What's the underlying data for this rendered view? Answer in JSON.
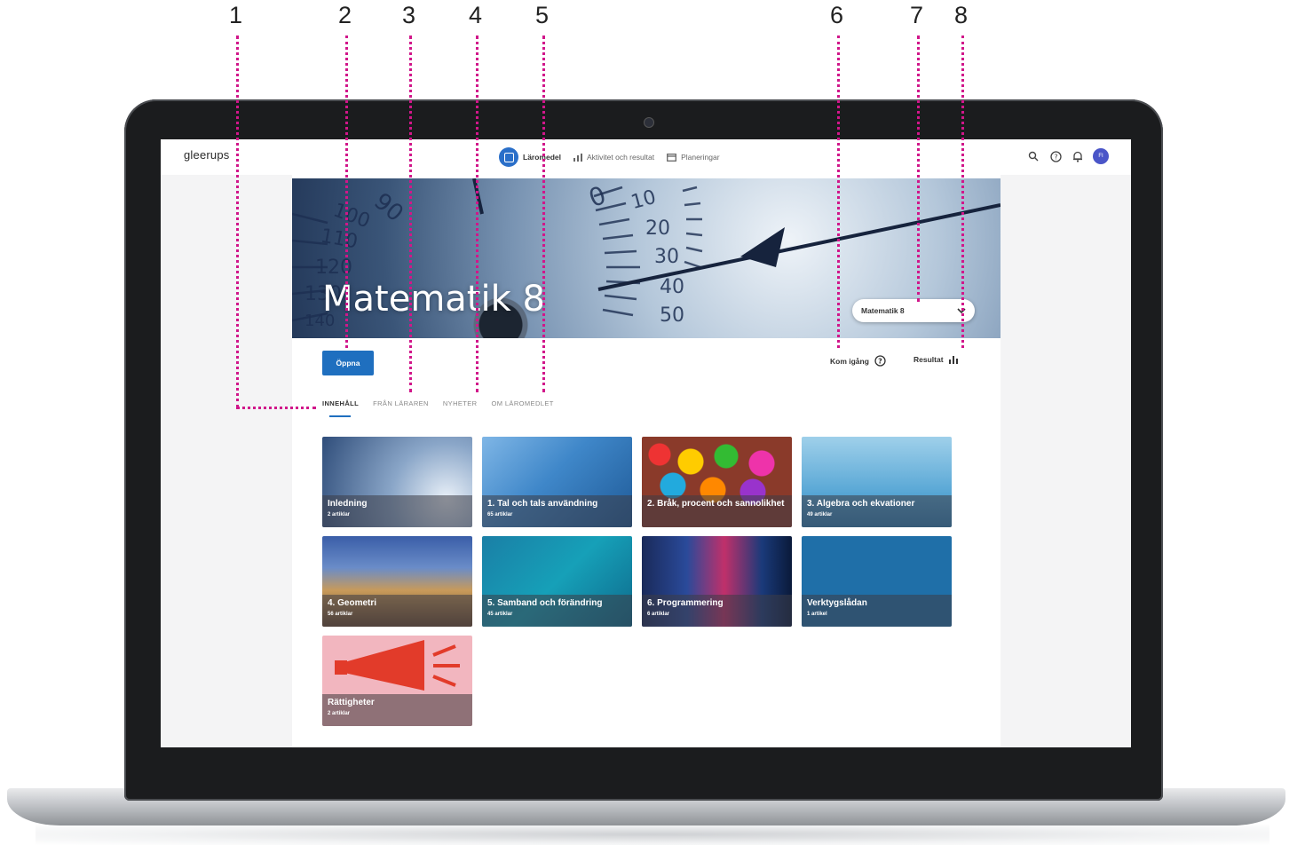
{
  "callouts": [
    "1",
    "2",
    "3",
    "4",
    "5",
    "6",
    "7",
    "8"
  ],
  "header": {
    "logo": "gleerups",
    "nav": [
      {
        "label": "Läromedel",
        "active": true
      },
      {
        "label": "Aktivitet och resultat",
        "active": false
      },
      {
        "label": "Planeringar",
        "active": false
      }
    ],
    "avatar_initials": "FI"
  },
  "hero": {
    "title": "Matematik 8",
    "dial_numbers": [
      "100",
      "90",
      "110",
      "120",
      "130",
      "140",
      "0",
      "10",
      "20",
      "30",
      "40",
      "50"
    ],
    "version_select": "Matematik 8"
  },
  "actions": {
    "open_label": "Öppna",
    "get_started_label": "Kom igång",
    "results_label": "Resultat"
  },
  "tabs": [
    "INNEHÅLL",
    "FRÅN LÄRAREN",
    "NYHETER",
    "OM LÄROMEDLET"
  ],
  "cards": [
    {
      "title": "Inledning",
      "count": "2 artiklar"
    },
    {
      "title": "1. Tal och tals användning",
      "count": "65 artiklar"
    },
    {
      "title": "2. Bråk, procent och sannolikhet",
      "count": ""
    },
    {
      "title": "3. Algebra och ekvationer",
      "count": "49 artiklar"
    },
    {
      "title": "4. Geometri",
      "count": "56 artiklar"
    },
    {
      "title": "5. Samband och förändring",
      "count": "45 artiklar"
    },
    {
      "title": "6. Programmering",
      "count": "6 artiklar"
    },
    {
      "title": "Verktygslådan",
      "count": "1 artikel"
    },
    {
      "title": "Rättigheter",
      "count": "2 artiklar"
    }
  ],
  "colors": {
    "accent": "#1f6fbf",
    "callout": "#d1168a",
    "avatar": "#4a55c8"
  }
}
